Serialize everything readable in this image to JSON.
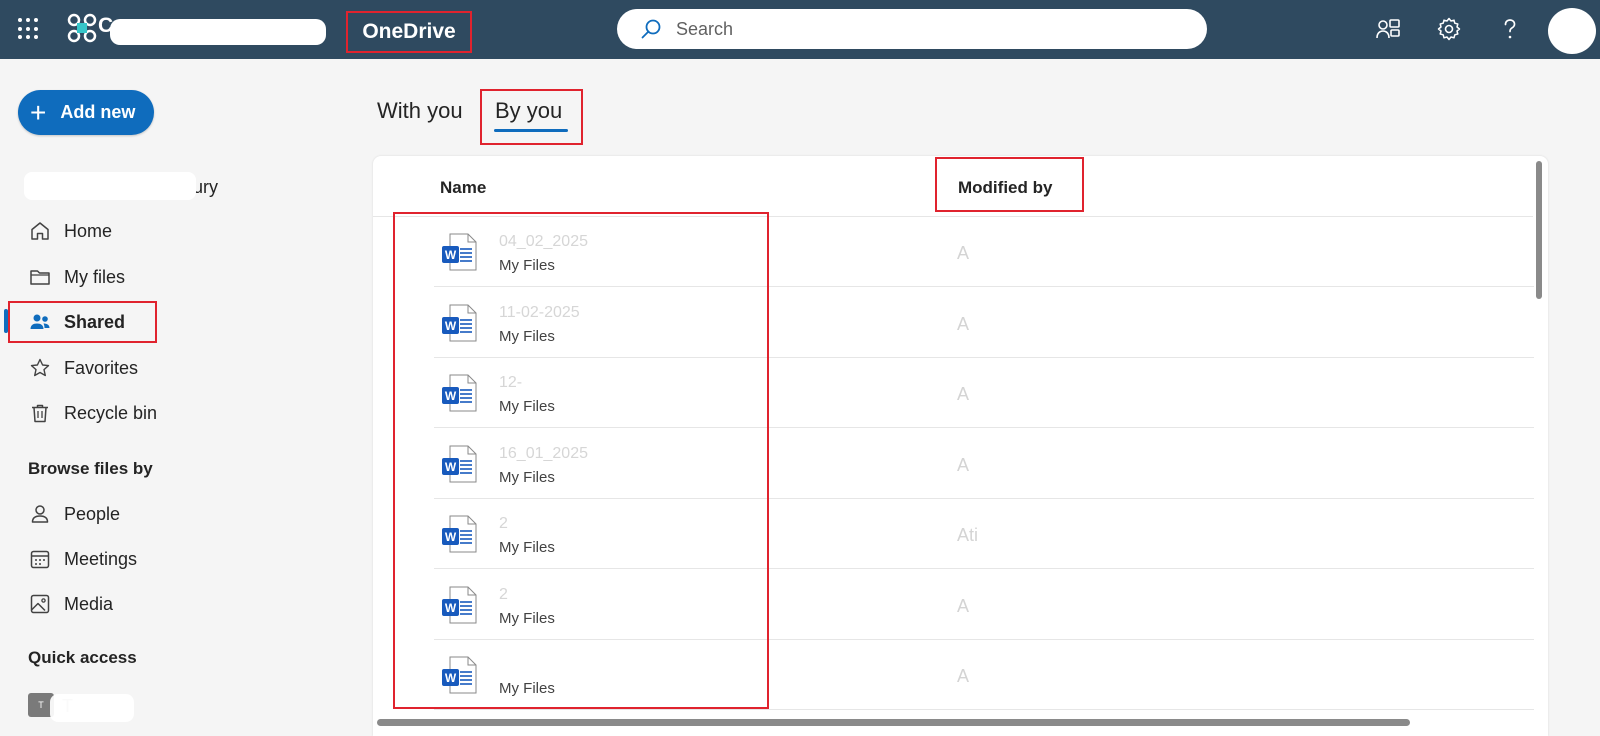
{
  "header": {
    "org_name": "C",
    "app_name": "OneDrive",
    "search_placeholder": "Search"
  },
  "sidebar": {
    "add_new_label": "Add new",
    "user_name": "wdury",
    "nav": [
      {
        "label": "Home",
        "icon": "home-icon"
      },
      {
        "label": "My files",
        "icon": "folder-icon"
      },
      {
        "label": "Shared",
        "icon": "people-icon",
        "active": true
      },
      {
        "label": "Favorites",
        "icon": "star-icon"
      },
      {
        "label": "Recycle bin",
        "icon": "trash-icon"
      }
    ],
    "browse_heading": "Browse files by",
    "browse": [
      {
        "label": "People",
        "icon": "person-icon"
      },
      {
        "label": "Meetings",
        "icon": "calendar-icon"
      },
      {
        "label": "Media",
        "icon": "image-icon"
      }
    ],
    "quick_access_heading": "Quick access",
    "quick_access_items": [
      {
        "thumb": "T",
        "label": "T"
      }
    ]
  },
  "tabs": [
    {
      "label": "With you",
      "selected": false
    },
    {
      "label": "By you",
      "selected": true
    }
  ],
  "list": {
    "columns": {
      "name": "Name",
      "modified_by": "Modified by"
    },
    "rows": [
      {
        "name": "04_02_2025",
        "location": "My Files",
        "modified_by": "A"
      },
      {
        "name": "11-02-2025",
        "location": "My Files",
        "modified_by": "A"
      },
      {
        "name": "12-",
        "location": "My Files",
        "modified_by": "A"
      },
      {
        "name": "16_01_2025",
        "location": "My Files",
        "modified_by": "A"
      },
      {
        "name": "2",
        "location": "My Files",
        "modified_by": "Ati"
      },
      {
        "name": "2",
        "location": "My Files",
        "modified_by": "A"
      },
      {
        "name": "",
        "location": "My Files",
        "modified_by": "A"
      }
    ]
  },
  "colors": {
    "topbar": "#2f4a60",
    "accent": "#0f6cbd",
    "highlight_box": "#e0232e"
  }
}
